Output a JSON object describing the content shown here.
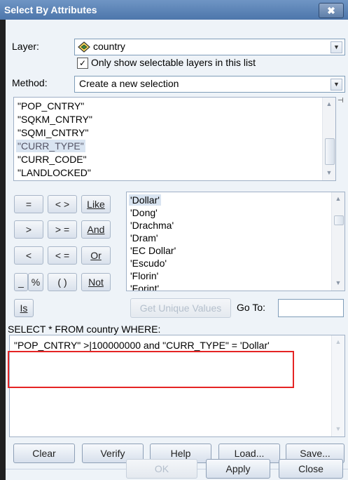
{
  "window": {
    "title": "Select By Attributes",
    "close_glyph": "✖"
  },
  "layer": {
    "label": "Layer:",
    "value": "country",
    "icon": "layer-diamond-icon"
  },
  "only_selectable": {
    "checked": true,
    "label": "Only show selectable layers in this list"
  },
  "method": {
    "label": "Method:",
    "value": "Create a new selection"
  },
  "fields": [
    "\"POP_CNTRY\"",
    "\"SQKM_CNTRY\"",
    "\"SQMI_CNTRY\"",
    "\"CURR_TYPE\"",
    "\"CURR_CODE\"",
    "\"LANDLOCKED\""
  ],
  "selected_field": "\"CURR_TYPE\"",
  "operators": [
    "=",
    "< >",
    "Like",
    ">",
    "> =",
    "And",
    "<",
    "< =",
    "Or",
    "_",
    "%",
    "( )",
    "Not",
    "Is"
  ],
  "values": [
    "'Dollar'",
    "'Dong'",
    "'Drachma'",
    "'Dram'",
    "'EC Dollar'",
    "'Escudo'",
    "'Florin'",
    "'Forint'"
  ],
  "selected_value": "'Dollar'",
  "get_unique_values": "Get Unique Values",
  "goto_label": "Go To:",
  "goto_value": "",
  "query_label": "SELECT * FROM country WHERE:",
  "query_text": "\"POP_CNTRY\" >|100000000 and \"CURR_TYPE\" = 'Dollar'",
  "buttons": {
    "clear": "Clear",
    "verify": "Verify",
    "help": "Help",
    "load": "Load...",
    "save": "Save..."
  },
  "dialog_buttons": {
    "ok": "OK",
    "apply": "Apply",
    "close": "Close"
  },
  "colors": {
    "title_bar": "#5f87bb",
    "selection": "#d9e4f1",
    "highlight_box": "#e52424"
  }
}
